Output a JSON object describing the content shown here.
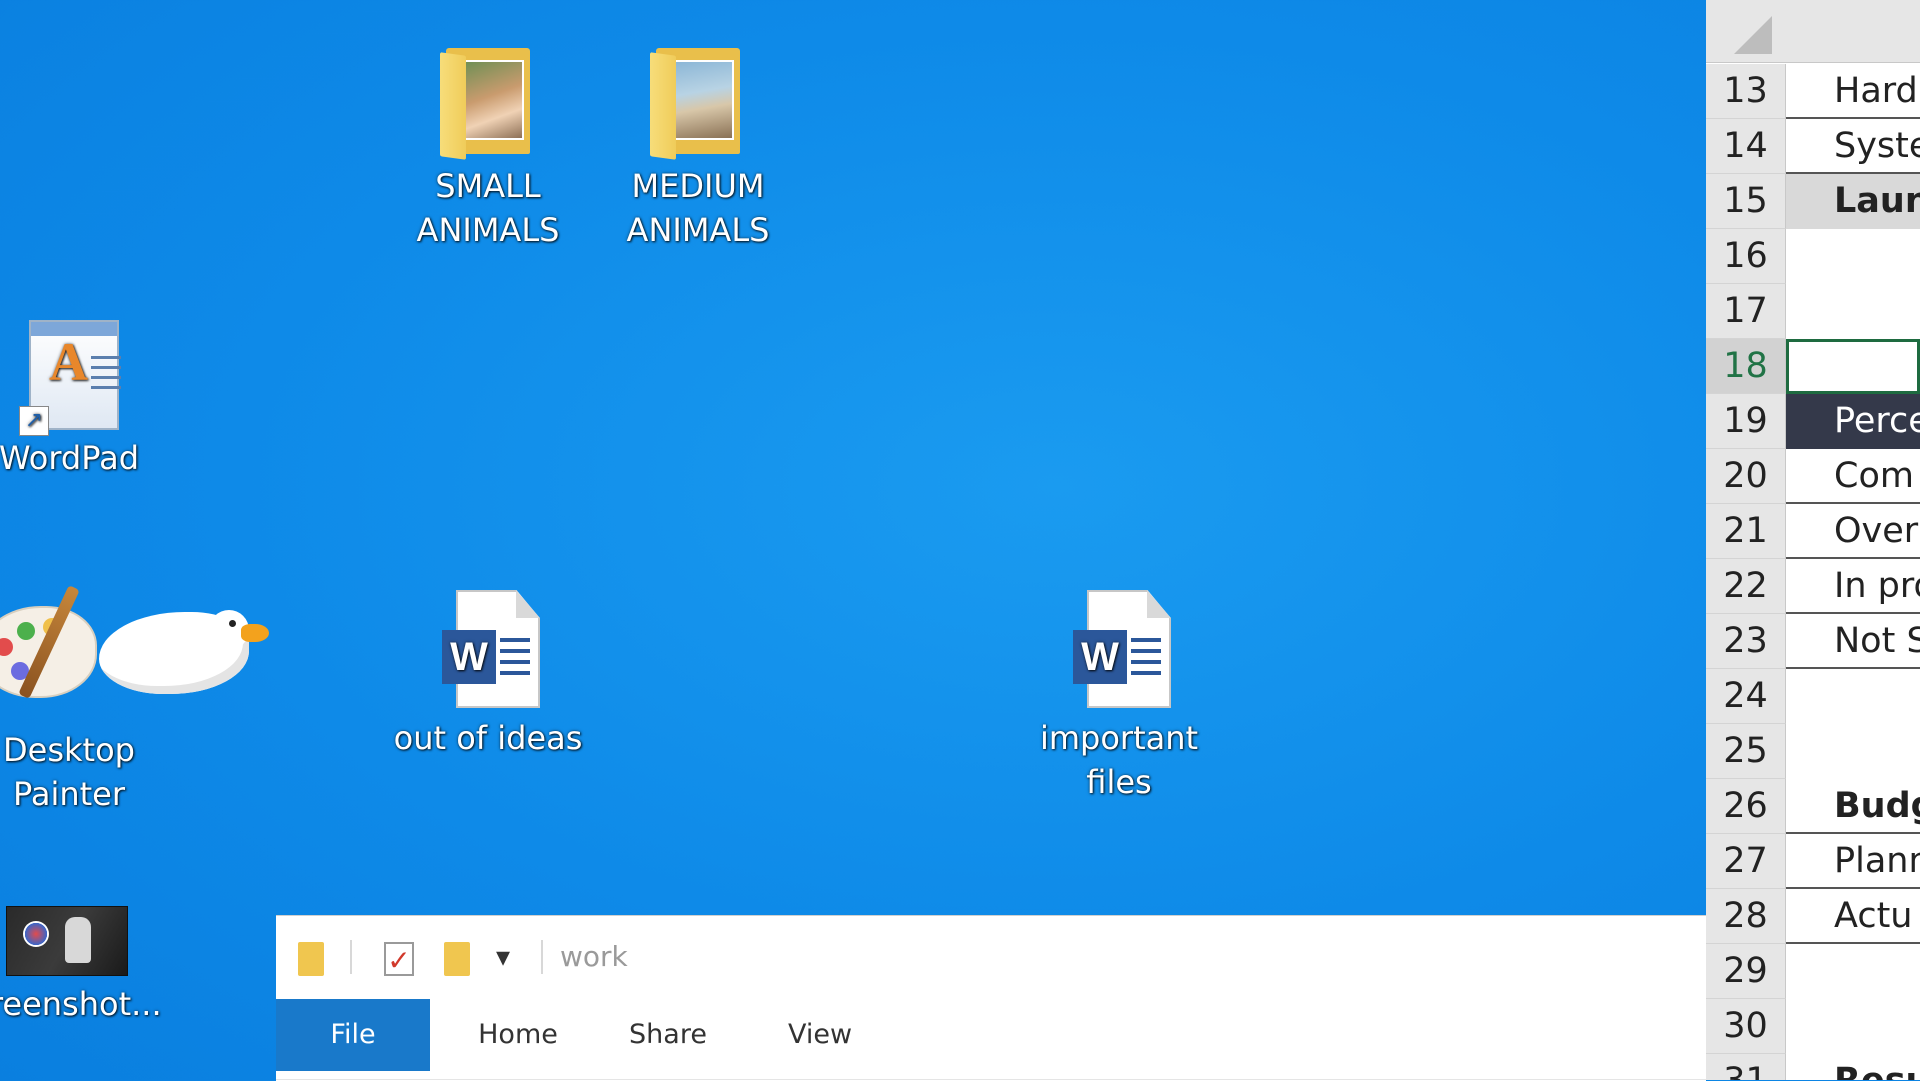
{
  "desktop": {
    "icons": [
      {
        "label_line1": "SMALL",
        "label_line2": "ANIMALS"
      },
      {
        "label_line1": "MEDIUM",
        "label_line2": "ANIMALS"
      },
      {
        "label": "WordPad"
      },
      {
        "label_line1": "Desktop",
        "label_line2": "Painter"
      },
      {
        "label": "out of ideas"
      },
      {
        "label_line1": "important",
        "label_line2": "files"
      },
      {
        "label": "creenshot..."
      }
    ]
  },
  "explorer": {
    "title": "work",
    "quick_access": {
      "dropdown_glyph": "▾",
      "check_glyph": "✓"
    },
    "tabs": [
      "File",
      "Home",
      "Share",
      "View"
    ]
  },
  "excel": {
    "rows": [
      {
        "num": "13",
        "text": "Hard"
      },
      {
        "num": "14",
        "text": "Syste"
      },
      {
        "num": "15",
        "text": "Launc"
      },
      {
        "num": "16",
        "text": ""
      },
      {
        "num": "17",
        "text": ""
      },
      {
        "num": "18",
        "text": ""
      },
      {
        "num": "19",
        "text": "Perce"
      },
      {
        "num": "20",
        "text": "Com"
      },
      {
        "num": "21",
        "text": "Over"
      },
      {
        "num": "22",
        "text": "In pro"
      },
      {
        "num": "23",
        "text": "Not S"
      },
      {
        "num": "24",
        "text": ""
      },
      {
        "num": "25",
        "text": ""
      },
      {
        "num": "26",
        "text": "Budg"
      },
      {
        "num": "27",
        "text": "Plann"
      },
      {
        "num": "28",
        "text": "Actu"
      },
      {
        "num": "29",
        "text": ""
      },
      {
        "num": "30",
        "text": ""
      },
      {
        "num": "31",
        "text": "Resul"
      }
    ]
  },
  "colors": {
    "desktop_blue": "#0e8ae8",
    "file_tab": "#1979ca",
    "word_blue": "#2b579a",
    "excel_green": "#217346",
    "header_dark": "#34394a"
  }
}
